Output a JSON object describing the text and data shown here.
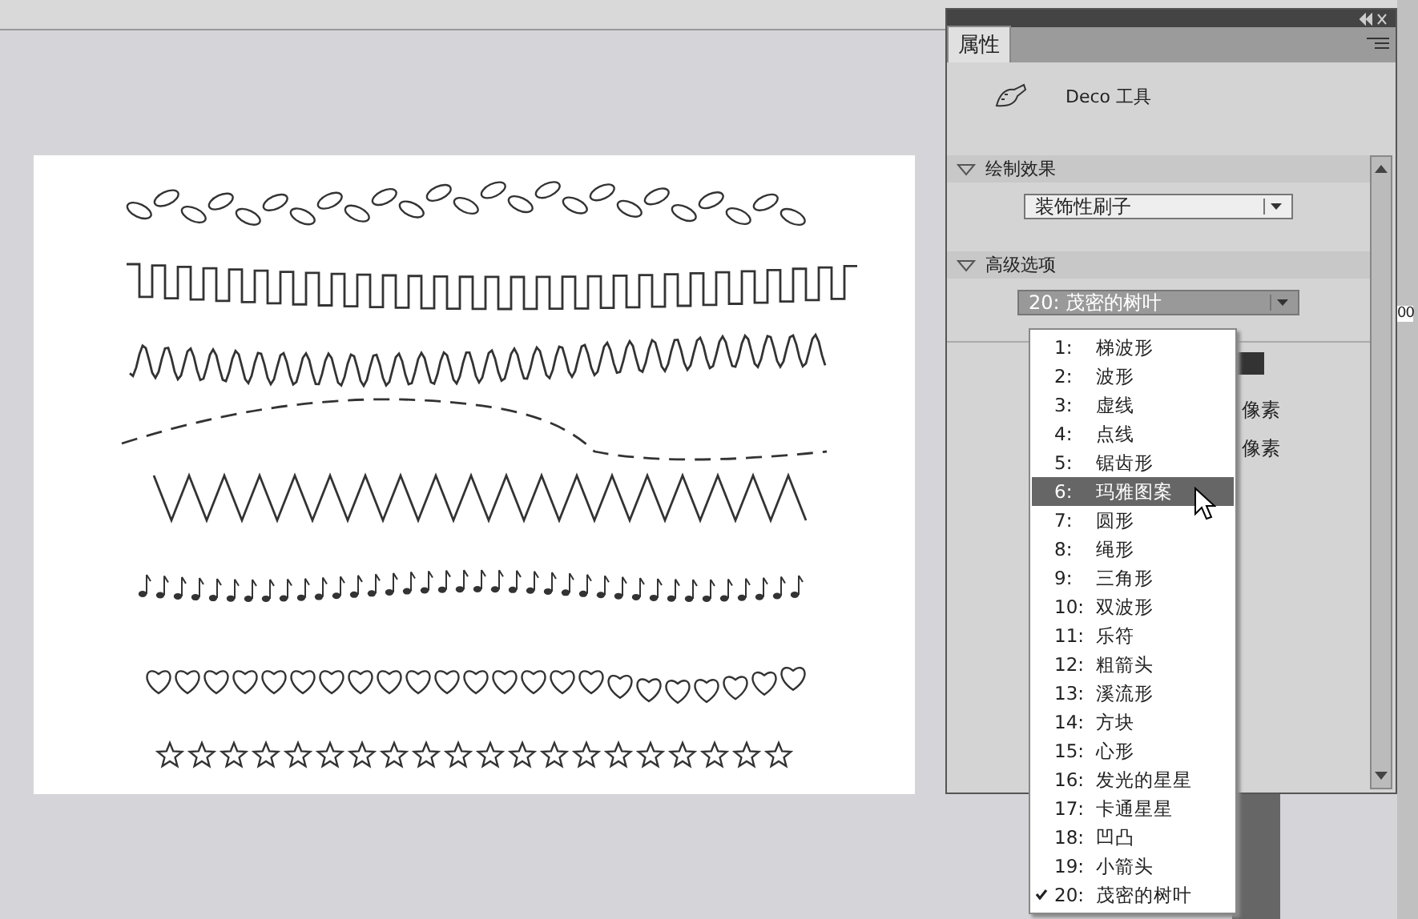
{
  "panel": {
    "tab": "属性",
    "tool_name": "Deco 工具",
    "sections": [
      {
        "title": "绘制效果",
        "expanded": true,
        "dropdown": "装饰性刷子"
      },
      {
        "title": "高级选项",
        "expanded": true,
        "dropdown": "20: 茂密的树叶"
      }
    ],
    "fields": [
      {
        "value": "像素"
      },
      {
        "value": "像素"
      }
    ]
  },
  "edge_fragment": "00",
  "dropdown_list": {
    "items": [
      {
        "number": "1:",
        "label": "梯波形",
        "selected": false,
        "checked": false
      },
      {
        "number": "2:",
        "label": "波形",
        "selected": false,
        "checked": false
      },
      {
        "number": "3:",
        "label": "虚线",
        "selected": false,
        "checked": false
      },
      {
        "number": "4:",
        "label": "点线",
        "selected": false,
        "checked": false
      },
      {
        "number": "5:",
        "label": "锯齿形",
        "selected": false,
        "checked": false
      },
      {
        "number": "6:",
        "label": "玛雅图案",
        "selected": true,
        "checked": false
      },
      {
        "number": "7:",
        "label": "圆形",
        "selected": false,
        "checked": false
      },
      {
        "number": "8:",
        "label": "绳形",
        "selected": false,
        "checked": false
      },
      {
        "number": "9:",
        "label": "三角形",
        "selected": false,
        "checked": false
      },
      {
        "number": "10:",
        "label": "双波形",
        "selected": false,
        "checked": false
      },
      {
        "number": "11:",
        "label": "乐符",
        "selected": false,
        "checked": false
      },
      {
        "number": "12:",
        "label": "粗箭头",
        "selected": false,
        "checked": false
      },
      {
        "number": "13:",
        "label": "溪流形",
        "selected": false,
        "checked": false
      },
      {
        "number": "14:",
        "label": "方块",
        "selected": false,
        "checked": false
      },
      {
        "number": "15:",
        "label": "心形",
        "selected": false,
        "checked": false
      },
      {
        "number": "16:",
        "label": "发光的星星",
        "selected": false,
        "checked": false
      },
      {
        "number": "17:",
        "label": "卡通星星",
        "selected": false,
        "checked": false
      },
      {
        "number": "18:",
        "label": "凹凸",
        "selected": false,
        "checked": false
      },
      {
        "number": "19:",
        "label": "小箭头",
        "selected": false,
        "checked": false
      },
      {
        "number": "20:",
        "label": "茂密的树叶",
        "selected": false,
        "checked": true
      }
    ]
  }
}
